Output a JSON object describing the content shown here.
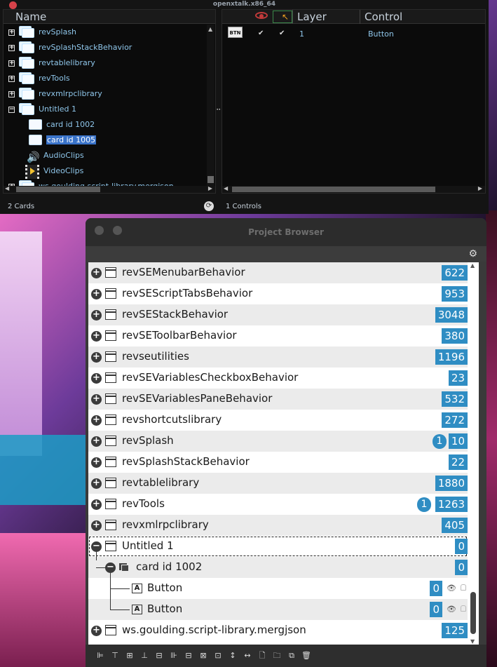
{
  "app": {
    "title": "openxtalk.x86_64",
    "left_header": "Name",
    "right_headers": {
      "layer": "Layer",
      "control": "Control"
    },
    "tree": [
      {
        "label": "revSplash",
        "kind": "stack"
      },
      {
        "label": "revSplashStackBehavior",
        "kind": "stack"
      },
      {
        "label": "revtablelibrary",
        "kind": "stack"
      },
      {
        "label": "revTools",
        "kind": "stack"
      },
      {
        "label": "revxmlrpclibrary",
        "kind": "stack"
      },
      {
        "label": "Untitled 1",
        "kind": "stack-open"
      },
      {
        "label": "card id 1002",
        "kind": "card"
      },
      {
        "label": "card id 1005",
        "kind": "card-selected"
      },
      {
        "label": "AudioClips",
        "kind": "audio"
      },
      {
        "label": "VideoClips",
        "kind": "video"
      },
      {
        "label": "ws.goulding.script-library.mergjson",
        "kind": "stack"
      }
    ],
    "control_row": {
      "badge": "BTN",
      "layer": "1",
      "type": "Button"
    },
    "status_left": "2 Cards",
    "status_right": "1 Controls"
  },
  "project_browser": {
    "title": "Project Browser",
    "rows": [
      {
        "name": "revSEMenubarBehavior",
        "count": "622"
      },
      {
        "name": "revSEScriptTabsBehavior",
        "count": "953"
      },
      {
        "name": "revSEStackBehavior",
        "count": "3048"
      },
      {
        "name": "revSEToolbarBehavior",
        "count": "380"
      },
      {
        "name": "revseutilities",
        "count": "1196"
      },
      {
        "name": "revSEVariablesCheckboxBehavior",
        "count": "23"
      },
      {
        "name": "revSEVariablesPaneBehavior",
        "count": "532"
      },
      {
        "name": "revshortcutslibrary",
        "count": "272"
      },
      {
        "name": "revSplash",
        "count": "10",
        "badge": "1"
      },
      {
        "name": "revSplashStackBehavior",
        "count": "22"
      },
      {
        "name": "revtablelibrary",
        "count": "1880"
      },
      {
        "name": "revTools",
        "count": "1263",
        "badge": "1"
      },
      {
        "name": "revxmlrpclibrary",
        "count": "405"
      },
      {
        "name": "Untitled 1",
        "count": "0"
      },
      {
        "name": "card id 1002",
        "count": "0"
      },
      {
        "name": "Button",
        "count": "0"
      },
      {
        "name": "Button",
        "count": "0"
      },
      {
        "name": "ws.goulding.script-library.mergjson",
        "count": "125"
      }
    ],
    "toolbar_icons": [
      "align-left-icon",
      "align-top-icon",
      "align-center-icon",
      "align-bottom-icon",
      "align-middle-icon",
      "distribute-h-icon",
      "distribute-v-icon",
      "space-icon",
      "arrange-icon",
      "height-icon",
      "width-icon",
      "new-file-icon",
      "open-folder-icon",
      "duplicate-icon",
      "trash-icon"
    ]
  },
  "colors": {
    "accent": "#2f8dc3",
    "selection": "#3a73c9",
    "close": "#d6424a"
  }
}
